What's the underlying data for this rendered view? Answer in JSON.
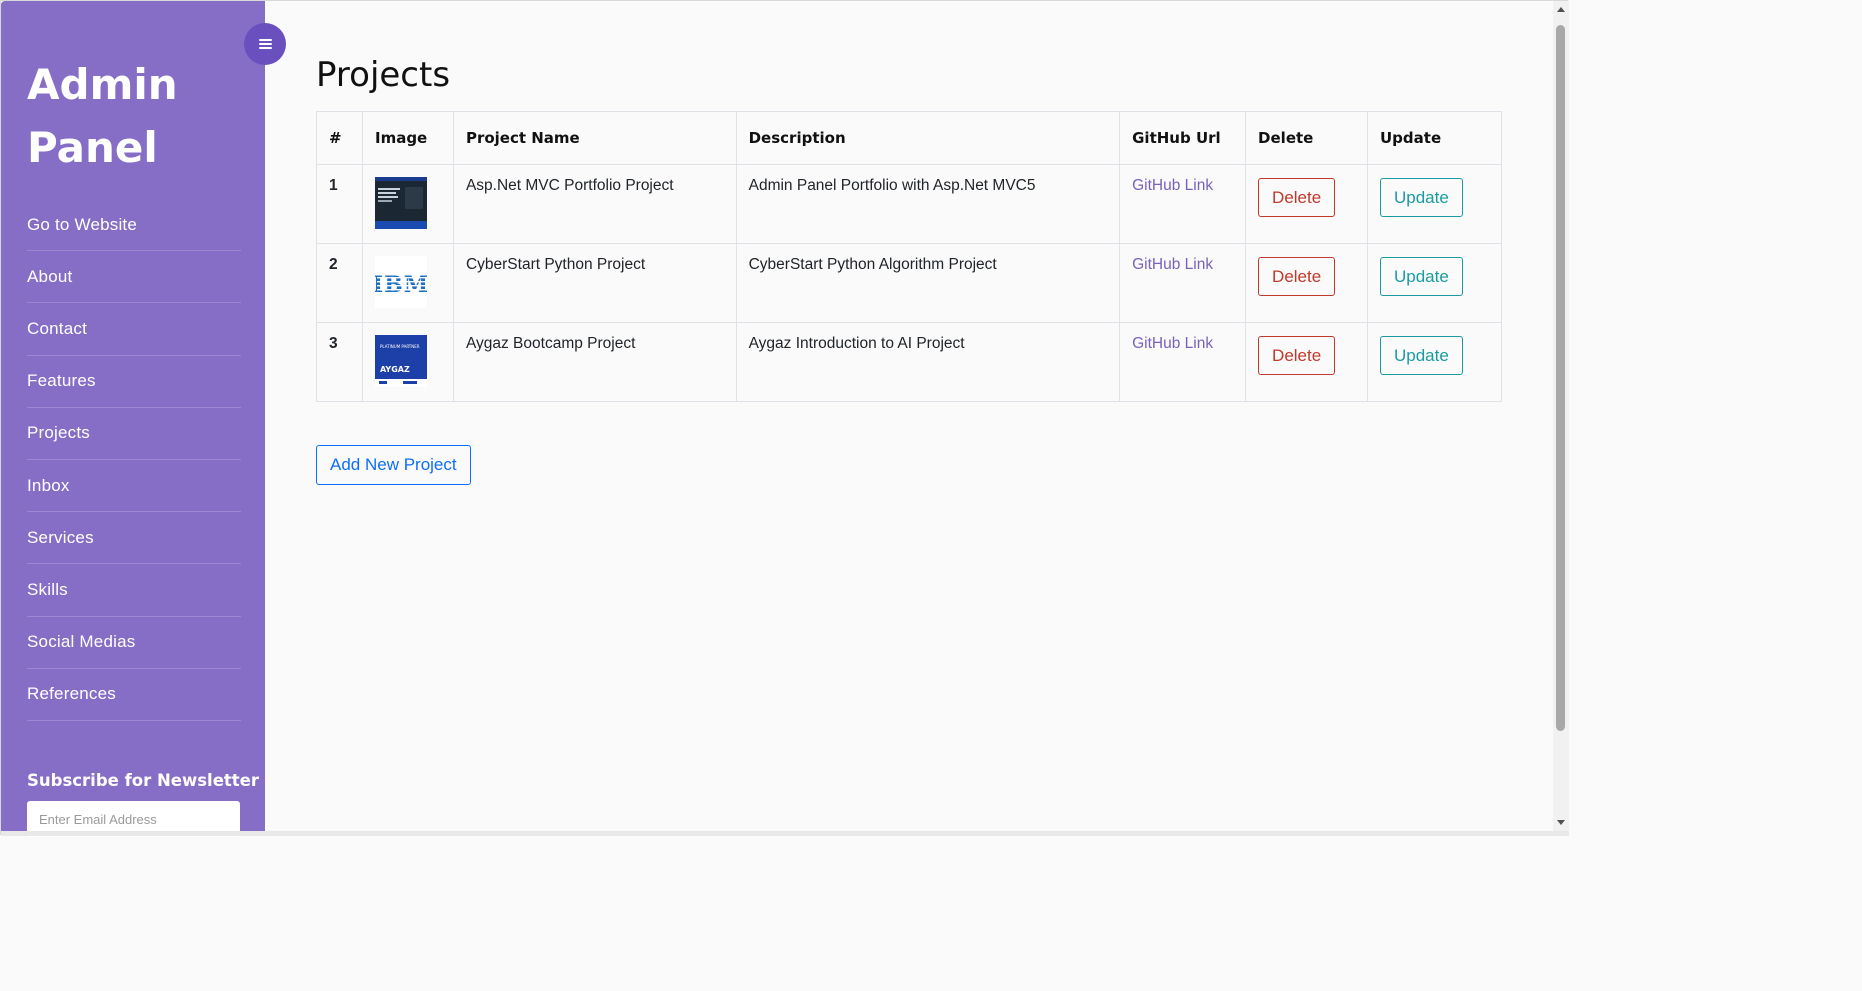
{
  "sidebar": {
    "brand": "Admin Panel",
    "menu": [
      {
        "label": "Go to Website"
      },
      {
        "label": "About"
      },
      {
        "label": "Contact"
      },
      {
        "label": "Features"
      },
      {
        "label": "Projects"
      },
      {
        "label": "Inbox"
      },
      {
        "label": "Services"
      },
      {
        "label": "Skills"
      },
      {
        "label": "Social Medias"
      },
      {
        "label": "References"
      }
    ],
    "newsletter": {
      "title": "Subscribe for Newsletter",
      "placeholder": "Enter Email Address"
    },
    "toggle_icon": "hamburger-menu-icon"
  },
  "main": {
    "title": "Projects",
    "table": {
      "columns": [
        "#",
        "Image",
        "Project Name",
        "Description",
        "GitHub Url",
        "Delete",
        "Update"
      ],
      "rows": [
        {
          "id": "1",
          "image": "portfolio-thumbnail",
          "name": "Asp.Net MVC Portfolio Project",
          "description": "Admin Panel Portfolio with Asp.Net MVC5",
          "github": "GitHub Link",
          "delete": "Delete",
          "update": "Update"
        },
        {
          "id": "2",
          "image": "ibm-logo",
          "name": "CyberStart Python Project",
          "description": "CyberStart Python Algorithm Project",
          "github": "GitHub Link",
          "delete": "Delete",
          "update": "Update"
        },
        {
          "id": "3",
          "image": "aygaz-thumbnail",
          "name": "Aygaz Bootcamp Project",
          "description": "Aygaz Introduction to AI Project",
          "github": "GitHub Link",
          "delete": "Delete",
          "update": "Update"
        }
      ]
    },
    "add_button": "Add New Project",
    "thumb_text": {
      "ibm": "IBM",
      "aygaz_badge": "PLATINUM PARTNER",
      "aygaz": "AYGAZ"
    }
  },
  "colors": {
    "sidebar_bg": "#866ec7",
    "toggle_bg": "#6a4fbf",
    "link": "#7a62b8",
    "danger": "#c0392b",
    "info": "#1a9ba1",
    "primary": "#0d6efd"
  }
}
